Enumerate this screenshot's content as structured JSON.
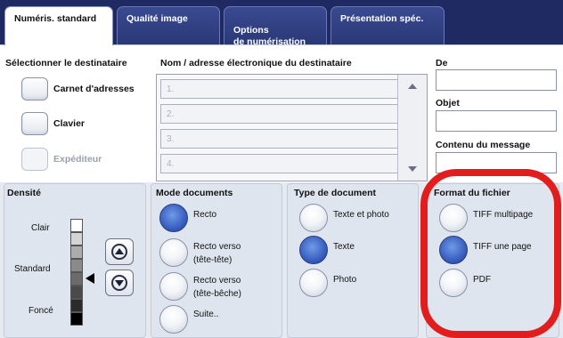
{
  "tabs": [
    {
      "label": "Numéris. standard",
      "active": true
    },
    {
      "label": "Qualité image"
    },
    {
      "label": "Options\nde numérisation"
    },
    {
      "label": "Présentation spéc."
    }
  ],
  "destination": {
    "heading": "Sélectionner le destinataire",
    "buttons": [
      {
        "label": "Carnet d'adresses",
        "enabled": true
      },
      {
        "label": "Clavier",
        "enabled": true
      },
      {
        "label": "Expéditeur",
        "enabled": false
      }
    ]
  },
  "recipients": {
    "heading": "Nom / adresse électronique du destinataire",
    "rows": [
      "1.",
      "2.",
      "3.",
      "4."
    ]
  },
  "right_fields": {
    "de": "De",
    "objet": "Objet",
    "contenu": "Contenu du message"
  },
  "densite": {
    "heading": "Densité",
    "light": "Clair",
    "standard": "Standard",
    "dark": "Foncé",
    "level": 4,
    "shades": [
      "#ffffff",
      "#d4d4d4",
      "#acacac",
      "#8a8a8a",
      "#6b6b6b",
      "#4a4a4a",
      "#2b2b2b",
      "#000000"
    ]
  },
  "mode_documents": {
    "heading": "Mode documents",
    "options": [
      {
        "label": "Recto",
        "selected": true
      },
      {
        "label": "Recto verso\n(tête-tête)",
        "selected": false
      },
      {
        "label": "Recto verso\n(tête-bêche)",
        "selected": false
      },
      {
        "label": "Suite..",
        "selected": false
      }
    ]
  },
  "type_document": {
    "heading": "Type de document",
    "options": [
      {
        "label": "Texte et photo",
        "selected": false
      },
      {
        "label": "Texte",
        "selected": true
      },
      {
        "label": "Photo",
        "selected": false
      }
    ]
  },
  "format_fichier": {
    "heading": "Format du fichier",
    "options": [
      {
        "label": "TIFF multipage",
        "selected": false
      },
      {
        "label": "TIFF une page",
        "selected": true
      },
      {
        "label": "PDF",
        "selected": false
      }
    ]
  },
  "colors": {
    "highlight": "#e21d1d",
    "tabbar": "#1f2a63",
    "selected": "#3d64c4"
  }
}
